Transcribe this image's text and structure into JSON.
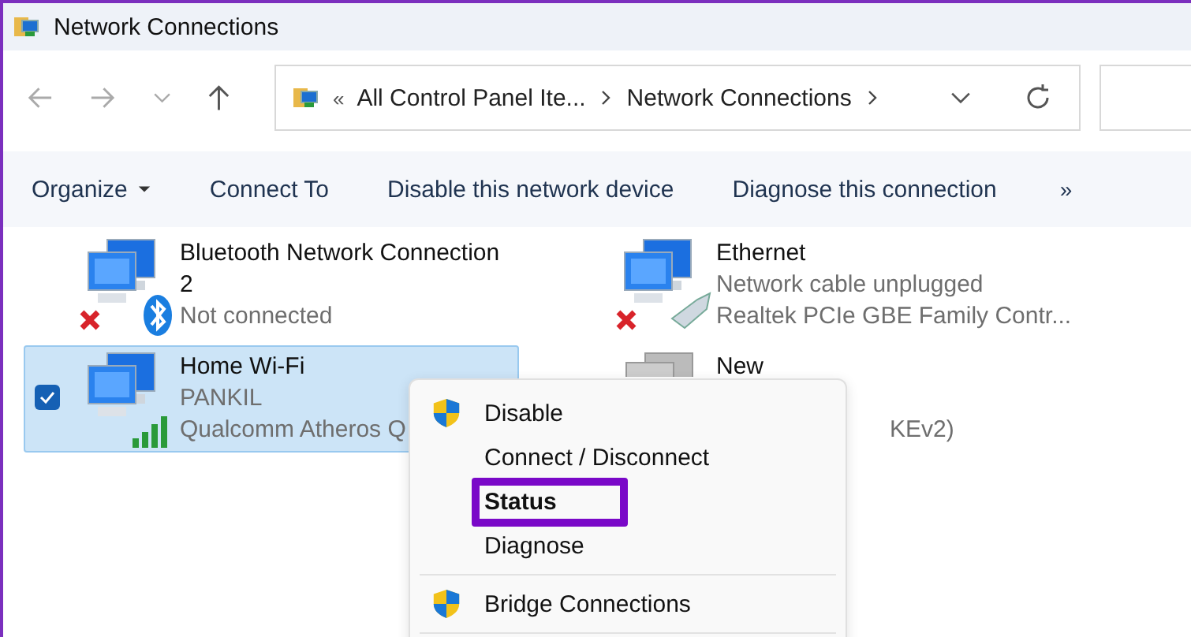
{
  "window": {
    "title": "Network Connections"
  },
  "address_bar": {
    "overflow_marker": "«",
    "segments": [
      "All Control Panel Ite...",
      "Network Connections"
    ]
  },
  "toolbar": {
    "items": [
      {
        "label": "Organize",
        "kind": "dropdown"
      },
      {
        "label": "Connect To",
        "kind": "button"
      },
      {
        "label": "Disable this network device",
        "kind": "button"
      },
      {
        "label": "Diagnose this connection",
        "kind": "button"
      }
    ],
    "overflow": "»"
  },
  "connections": [
    {
      "name": "Bluetooth Network Connection 2",
      "status": "Not connected",
      "kind": "bluetooth",
      "disconnected": true,
      "selected": false
    },
    {
      "name": "Ethernet",
      "status": "Network cable unplugged",
      "device": "Realtek PCIe GBE Family Contr...",
      "kind": "ethernet",
      "disconnected": true,
      "selected": false
    },
    {
      "name": "Home Wi-Fi",
      "status": "PANKIL",
      "device": "Qualcomm Atheros Q",
      "kind": "wifi",
      "disconnected": false,
      "selected": true
    },
    {
      "name": "New",
      "device": "KEv2)",
      "kind": "vpn",
      "disconnected": false,
      "selected": false,
      "partly_covered": true
    }
  ],
  "context_menu": {
    "items": [
      {
        "label": "Disable",
        "shield": true,
        "default": false,
        "highlighted": false,
        "separator_after": false
      },
      {
        "label": "Connect / Disconnect",
        "shield": false,
        "default": false,
        "highlighted": false,
        "separator_after": false
      },
      {
        "label": "Status",
        "shield": false,
        "default": true,
        "highlighted": true,
        "separator_after": false
      },
      {
        "label": "Diagnose",
        "shield": false,
        "default": false,
        "highlighted": false,
        "separator_after": true
      },
      {
        "label": "Bridge Connections",
        "shield": true,
        "default": false,
        "highlighted": false,
        "separator_after": true
      }
    ]
  }
}
